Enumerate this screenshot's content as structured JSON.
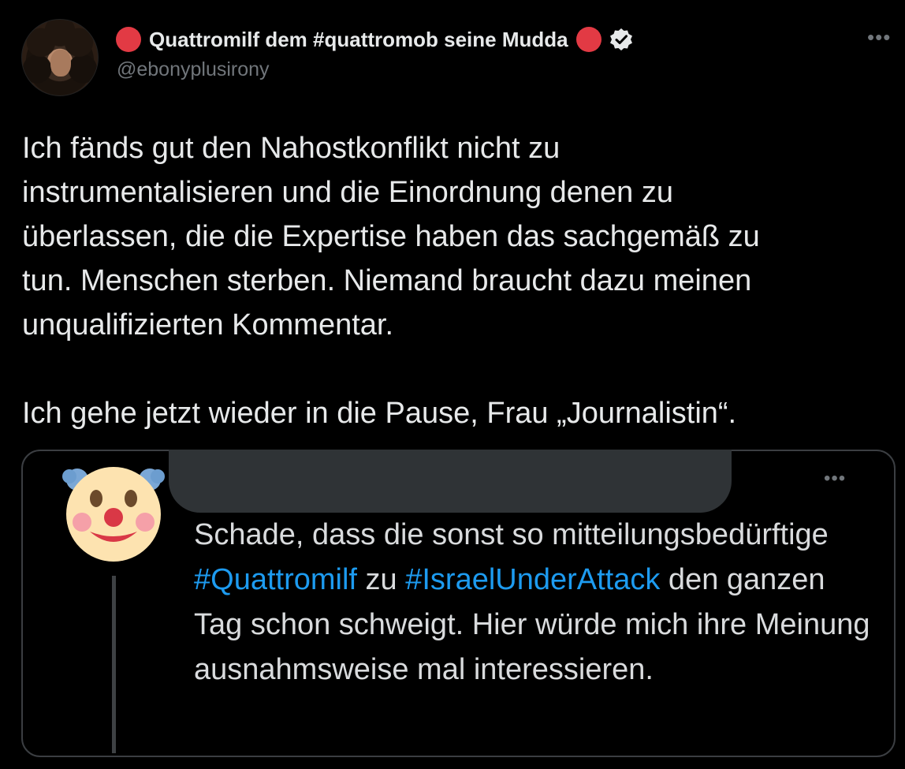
{
  "tweet": {
    "display_name": "Quattromilf dem #quattromob seine Mudda",
    "handle": "@ebonyplusirony",
    "text": "Ich fänds gut den Nahostkonflikt nicht zu\ninstrumentalisieren und die Einordnung denen zu\nüberlassen, die die Expertise haben das sachgemäß zu\ntun. Menschen sterben. Niemand braucht dazu meinen\nunqualifizierten Kommentar.\n\nIch gehe jetzt wieder in die Pause, Frau „Journalistin“.",
    "more_label": "•••"
  },
  "quote": {
    "more_label": "•••",
    "text_part1": "Schade, dass die sonst so mitteilungsbedürftige ",
    "hashtag1": "#Quattromilf",
    "text_part2": " zu ",
    "hashtag2": "#IsraelUnderAttack",
    "text_part3": " den ganzen Tag schon schweigt. Hier würde mich ihre Meinung ausnahmsweise mal interessieren."
  },
  "colors": {
    "background": "#000000",
    "text": "#e7e9ea",
    "muted": "#71767b",
    "accent": "#1d9bf0",
    "red_dot": "#e23a44"
  },
  "icons": {
    "verified": "verified-badge-icon",
    "more": "more-horizontal-icon",
    "clown": "clown-face-emoji"
  }
}
